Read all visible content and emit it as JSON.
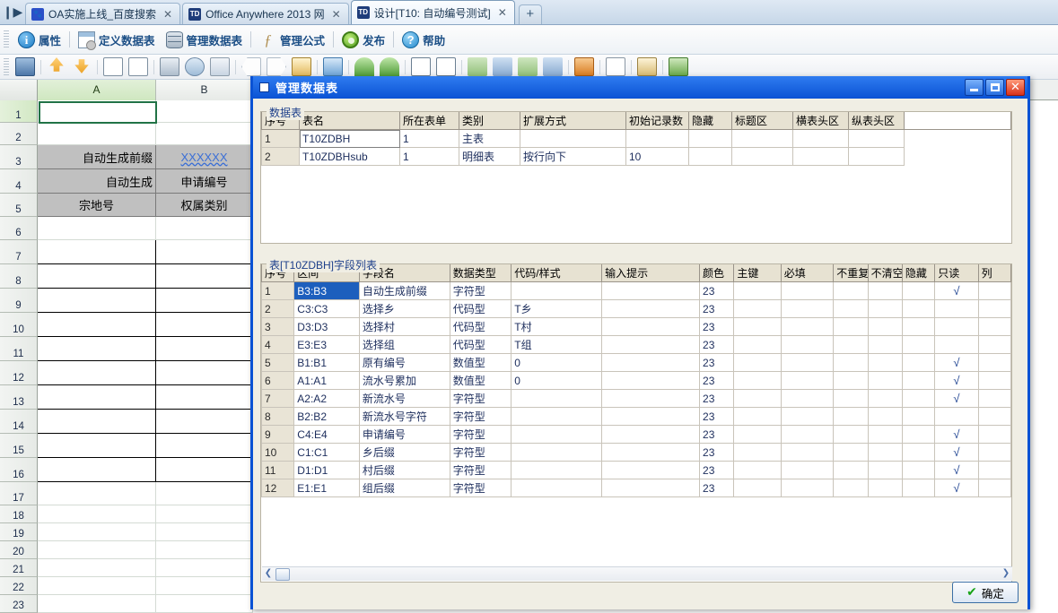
{
  "browser": {
    "tabs": [
      {
        "title": "OA实施上线_百度搜索",
        "favicon": "baidu-paw-icon",
        "active": false
      },
      {
        "title": "Office Anywhere 2013 网",
        "favicon": "td-icon",
        "active": false
      },
      {
        "title": "设计[T10: 自动编号测试]",
        "favicon": "td-icon",
        "active": true
      }
    ],
    "close_glyph": "✕",
    "newtab_glyph": "+",
    "sidebar_toggle_glyph": "❙▶"
  },
  "toolbar": {
    "items": [
      {
        "label": "属性",
        "icon": "info-icon"
      },
      {
        "label": "定义数据表",
        "icon": "define-table-icon"
      },
      {
        "label": "管理数据表",
        "icon": "manage-table-icon"
      },
      {
        "label": "管理公式",
        "icon": "formula-fx-icon"
      },
      {
        "label": "发布",
        "icon": "publish-gear-icon"
      },
      {
        "label": "帮助",
        "icon": "help-question-icon"
      }
    ]
  },
  "sheet": {
    "columns": [
      "A",
      "B"
    ],
    "selected_column": "A",
    "selected_cell": "A1",
    "rows": [
      "1",
      "2",
      "3",
      "4",
      "5",
      "6",
      "7",
      "8",
      "9",
      "10",
      "11",
      "12",
      "13",
      "14",
      "15",
      "16",
      "17",
      "18",
      "19",
      "20",
      "21",
      "22",
      "23"
    ],
    "cells": [
      {
        "row": 3,
        "col": "A",
        "text": "自动生成前缀",
        "align": "right",
        "filled": true
      },
      {
        "row": 3,
        "col": "B",
        "text": "XXXXXX",
        "align": "center",
        "filled": true,
        "style": "link-wavy"
      },
      {
        "row": 4,
        "col": "A",
        "text": "自动生成",
        "align": "right",
        "filled": true
      },
      {
        "row": 4,
        "col": "B",
        "text": "申请编号",
        "align": "center",
        "filled": true
      },
      {
        "row": 5,
        "col": "A",
        "text": "宗地号",
        "align": "center",
        "filled": true
      },
      {
        "row": 5,
        "col": "B",
        "text": "权属类别",
        "align": "center",
        "filled": true
      }
    ]
  },
  "side_actions": {
    "top": [
      "delete-icon",
      "move-up-icon",
      "move-down-icon"
    ],
    "bottom": [
      "delete-icon",
      "move-up-icon",
      "move-down-icon"
    ]
  },
  "dialog": {
    "title": "管理数据表",
    "window_buttons": [
      "minimize",
      "maximize",
      "close"
    ],
    "close_glyph": "✕",
    "ok_button": {
      "label": "确定",
      "check": "✔"
    },
    "datatable_group": {
      "legend": "数据表",
      "headers": [
        "序号",
        "表名",
        "所在表单",
        "类别",
        "扩展方式",
        "初始记录数",
        "隐藏",
        "标题区",
        "横表头区",
        "纵表头区"
      ],
      "rows": [
        {
          "序号": "1",
          "表名": "T10ZDBH",
          "所在表单": "1",
          "类别": "主表",
          "扩展方式": "",
          "初始记录数": "",
          "隐藏": "",
          "标题区": "",
          "横表头区": "",
          "纵表头区": "",
          "editing": true
        },
        {
          "序号": "2",
          "表名": "T10ZDBHsub",
          "所在表单": "1",
          "类别": "明细表",
          "扩展方式": "按行向下",
          "初始记录数": "10",
          "隐藏": "",
          "标题区": "",
          "横表头区": "",
          "纵表头区": "",
          "editing": false
        }
      ]
    },
    "fieldlist_group": {
      "legend": "表[T10ZDBH]字段列表",
      "headers": [
        "序号",
        "区间",
        "字段名",
        "数据类型",
        "代码/样式",
        "输入提示",
        "颜色",
        "主键",
        "必填",
        "不重复",
        "不清空",
        "隐藏",
        "只读",
        "列"
      ],
      "rows": [
        {
          "序号": "1",
          "区间": "B3:B3",
          "字段名": "自动生成前缀",
          "数据类型": "字符型",
          "代码/样式": "",
          "输入提示": "",
          "颜色": "23",
          "主键": "",
          "必填": "",
          "不重复": "",
          "不清空": "",
          "隐藏": "",
          "只读": "√",
          "selected": true
        },
        {
          "序号": "2",
          "区间": "C3:C3",
          "字段名": "选择乡",
          "数据类型": "代码型",
          "代码/样式": "T乡",
          "输入提示": "",
          "颜色": "23",
          "主键": "",
          "必填": "",
          "不重复": "",
          "不清空": "",
          "隐藏": "",
          "只读": "",
          "selected": false
        },
        {
          "序号": "3",
          "区间": "D3:D3",
          "字段名": "选择村",
          "数据类型": "代码型",
          "代码/样式": "T村",
          "输入提示": "",
          "颜色": "23",
          "主键": "",
          "必填": "",
          "不重复": "",
          "不清空": "",
          "隐藏": "",
          "只读": "",
          "selected": false
        },
        {
          "序号": "4",
          "区间": "E3:E3",
          "字段名": "选择组",
          "数据类型": "代码型",
          "代码/样式": "T组",
          "输入提示": "",
          "颜色": "23",
          "主键": "",
          "必填": "",
          "不重复": "",
          "不清空": "",
          "隐藏": "",
          "只读": "",
          "selected": false
        },
        {
          "序号": "5",
          "区间": "B1:B1",
          "字段名": "原有编号",
          "数据类型": "数值型",
          "代码/样式": "0",
          "输入提示": "",
          "颜色": "23",
          "主键": "",
          "必填": "",
          "不重复": "",
          "不清空": "",
          "隐藏": "",
          "只读": "√",
          "selected": false
        },
        {
          "序号": "6",
          "区间": "A1:A1",
          "字段名": "流水号累加",
          "数据类型": "数值型",
          "代码/样式": "0",
          "输入提示": "",
          "颜色": "23",
          "主键": "",
          "必填": "",
          "不重复": "",
          "不清空": "",
          "隐藏": "",
          "只读": "√",
          "selected": false
        },
        {
          "序号": "7",
          "区间": "A2:A2",
          "字段名": "新流水号",
          "数据类型": "字符型",
          "代码/样式": "",
          "输入提示": "",
          "颜色": "23",
          "主键": "",
          "必填": "",
          "不重复": "",
          "不清空": "",
          "隐藏": "",
          "只读": "√",
          "selected": false
        },
        {
          "序号": "8",
          "区间": "B2:B2",
          "字段名": "新流水号字符",
          "数据类型": "字符型",
          "代码/样式": "",
          "输入提示": "",
          "颜色": "23",
          "主键": "",
          "必填": "",
          "不重复": "",
          "不清空": "",
          "隐藏": "",
          "只读": "",
          "selected": false
        },
        {
          "序号": "9",
          "区间": "C4:E4",
          "字段名": "申请编号",
          "数据类型": "字符型",
          "代码/样式": "",
          "输入提示": "",
          "颜色": "23",
          "主键": "",
          "必填": "",
          "不重复": "",
          "不清空": "",
          "隐藏": "",
          "只读": "√",
          "selected": false
        },
        {
          "序号": "10",
          "区间": "C1:C1",
          "字段名": "乡后缀",
          "数据类型": "字符型",
          "代码/样式": "",
          "输入提示": "",
          "颜色": "23",
          "主键": "",
          "必填": "",
          "不重复": "",
          "不清空": "",
          "隐藏": "",
          "只读": "√",
          "selected": false
        },
        {
          "序号": "11",
          "区间": "D1:D1",
          "字段名": "村后缀",
          "数据类型": "字符型",
          "代码/样式": "",
          "输入提示": "",
          "颜色": "23",
          "主键": "",
          "必填": "",
          "不重复": "",
          "不清空": "",
          "隐藏": "",
          "只读": "√",
          "selected": false
        },
        {
          "序号": "12",
          "区间": "E1:E1",
          "字段名": "组后缀",
          "数据类型": "字符型",
          "代码/样式": "",
          "输入提示": "",
          "颜色": "23",
          "主键": "",
          "必填": "",
          "不重复": "",
          "不清空": "",
          "隐藏": "",
          "只读": "√",
          "selected": false
        }
      ],
      "hscroll": {
        "left_glyph": "❮",
        "right_glyph": "❯"
      }
    }
  },
  "colors": {
    "dialog_border": "#0a52d4",
    "title_bar": "#0a52d4",
    "selection_blue": "#1d5fbd",
    "grid_header": "#e7e2d2",
    "sheet_filled": "#c0c0c0",
    "accent_text": "#1c4f86"
  }
}
